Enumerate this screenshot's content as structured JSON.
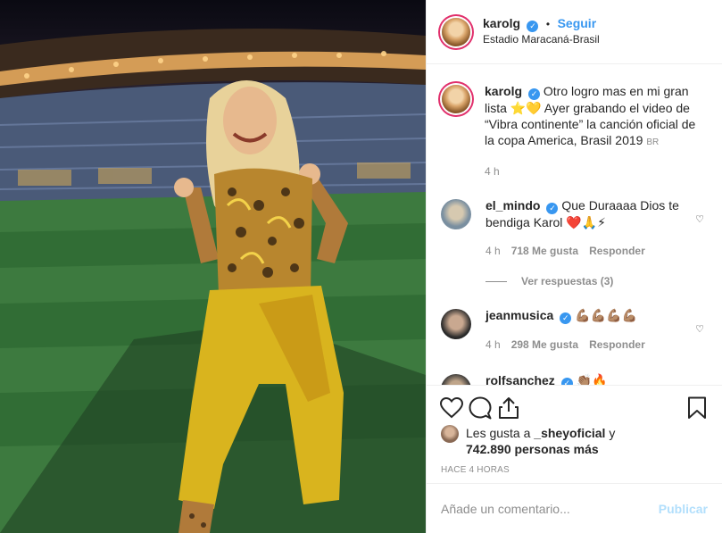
{
  "post": {
    "username": "karolg",
    "follow_label": "Seguir",
    "location": "Estadio Maracaná-Brasil"
  },
  "caption": {
    "username": "karolg",
    "text": "Otro logro mas en mi gran lista ⭐💛 Ayer grabando el video de “Vibra continente” la canción oficial de la copa America, Brasil 2019",
    "flag": "BR",
    "time": "4 h"
  },
  "comments": [
    {
      "username": "el_mindo",
      "text": "Que Duraaaa Dios te bendiga Karol ❤️🙏⚡",
      "time": "4 h",
      "likes": "718 Me gusta",
      "reply_label": "Responder",
      "view_replies": "Ver respuestas (3)"
    },
    {
      "username": "jeanmusica",
      "text": "💪🏽💪🏽💪🏽💪🏽",
      "time": "4 h",
      "likes": "298 Me gusta",
      "reply_label": "Responder"
    },
    {
      "username": "rolfsanchez",
      "text": "👏🏽🔥"
    }
  ],
  "likes": {
    "prefix": "Les gusta a",
    "user": "_sheyoficial",
    "conj": "y",
    "count": "742.890 personas más"
  },
  "timestamp": "HACE 4 HORAS",
  "comment_box": {
    "placeholder": "Añade un comentario...",
    "publish_label": "Publicar"
  },
  "icons": {
    "like": "heart-icon",
    "comment": "comment-icon",
    "share": "share-icon",
    "save": "bookmark-icon",
    "verified": "verified-badge-icon"
  },
  "colors": {
    "accent": "#3897f0",
    "muted": "#8e8e8e",
    "publish_disabled": "#b2dffc"
  }
}
